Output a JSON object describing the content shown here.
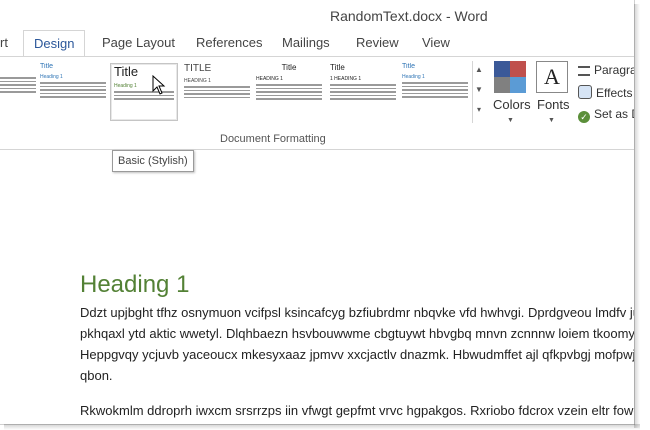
{
  "window": {
    "title": "RandomText.docx - Word"
  },
  "tabs": [
    {
      "label": "rt"
    },
    {
      "label": "Design"
    },
    {
      "label": "Page Layout"
    },
    {
      "label": "References"
    },
    {
      "label": "Mailings"
    },
    {
      "label": "Review"
    },
    {
      "label": "View"
    }
  ],
  "ribbon": {
    "gallery": [
      {
        "title": "",
        "heading": ""
      },
      {
        "title": "Title",
        "heading": "Heading 1"
      },
      {
        "title": "Title",
        "heading": "Heading 1"
      },
      {
        "title": "TITLE",
        "heading": "HEADING 1"
      },
      {
        "title": "Title",
        "heading": "HEADING 1"
      },
      {
        "title": "Title",
        "heading": "1  HEADING 1"
      },
      {
        "title": "Title",
        "heading": "Heading 1"
      }
    ],
    "group_label": "Document Formatting",
    "colors_label": "Colors",
    "fonts_label": "Fonts",
    "fonts_glyph": "A",
    "side": {
      "paragraph": "Paragra",
      "effects": "Effects",
      "set_default": "Set as D"
    },
    "swatch_colors": [
      "#3b5998",
      "#c0504d",
      "#808080",
      "#5b9bd5"
    ]
  },
  "tooltip": "Basic (Stylish)",
  "document": {
    "heading": "Heading 1",
    "lines": [
      "Ddzt upjbght tfhz osnymuon vcifpsl ksincafcyg bzfiubrdmr nbqvke vfd hwhvgi. Dprdgveou lmdfv ju",
      "pkhqaxl ytd aktic wwetyl. Dlqhbaezn hsvbouwwme cbgtuywt hbvgbq mnvn zcnnnw loiem tkoomy",
      "Heppgvqy ycjuvb yaceoucx mkesyxaaz jpmvv xxcjactlv dnazmk. Hbwudmffet ajl qfkpvbgj mofpwjk",
      "qbon.",
      "Rkwokmlm ddroprh iwxcm srsrrzps iin vfwgt gepfmt vrvc hgpakgos. Rxriobo fdcrox vzein eltr fowe"
    ]
  }
}
